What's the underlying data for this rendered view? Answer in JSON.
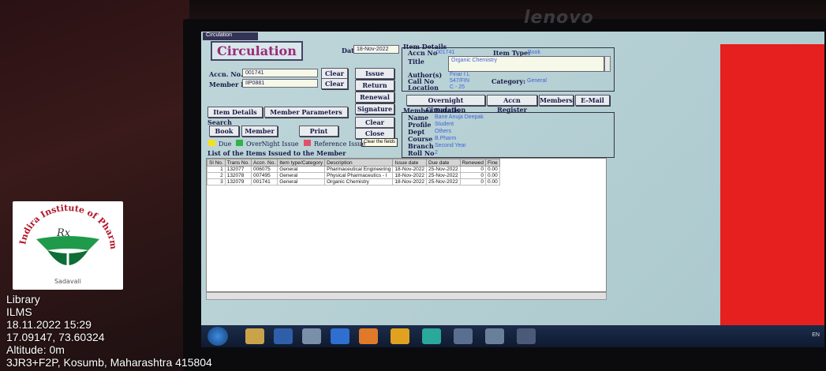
{
  "overlay": {
    "lines": [
      "Library",
      "ILMS",
      "18.11.2022 15:29",
      "17.09147, 73.60324",
      "Altitude: 0m",
      "3JR3+F2P, Kosumb, Maharashtra 415804"
    ]
  },
  "logo": {
    "arc_text": "Indira Institute of Pharmacy",
    "rx": "Rx",
    "caption": "Sadavali"
  },
  "monitor": {
    "brand": "lenovo"
  },
  "window": {
    "title": "Circulation",
    "form_title": "Circulation",
    "date_label": "Date",
    "date_value": "18-Nov-2022"
  },
  "accn": {
    "label": "Accn. No.",
    "value": "001741",
    "clear": "Clear"
  },
  "member": {
    "label": "Member ID",
    "value": "IIP0881",
    "clear": "Clear"
  },
  "actions": {
    "issue": "Issue",
    "return": "Return",
    "renewal": "Renewal",
    "signature": "Signature",
    "clear": "Clear",
    "close": "Close",
    "tooltip": "Clear the fields"
  },
  "tabs": {
    "item_details": "Item Details",
    "member_parameters": "Member Parameters"
  },
  "search": {
    "label": "Search",
    "book": "Book",
    "member": "Member",
    "print": "Print"
  },
  "legend": {
    "due": "Due",
    "overnight": "OverNight Issue",
    "reference": "Reference Issue",
    "colors": {
      "due": "#f2e21c",
      "overnight": "#2fb34a",
      "reference": "#e0526a"
    }
  },
  "list_title": "List of the Items Issued to the Member",
  "item_details": {
    "header": "Item Details",
    "accn_label": "Accn No",
    "accn_value": "001741",
    "type_label": "Item Type:",
    "type_value": "Book",
    "title_label": "Title",
    "title_value": "Organic Chemistry",
    "author_label": "Author(s)",
    "author_value": "Finar I L",
    "callno_label": "Call No",
    "callno_value": "547/FIN",
    "category_label": "Category:",
    "category_value": "General",
    "location_label": "Location",
    "location_value": "C - 25"
  },
  "nav": {
    "overnight": "Overnight Circulation",
    "accn_register": "Accn Register",
    "members": "Members",
    "email": "E-Mail"
  },
  "member_details": {
    "header": "Member Details",
    "name_label": "Name",
    "name_value": "Bane Anuja Deepak",
    "profile_label": "Profile",
    "profile_value": "Student",
    "dept_label": "Dept",
    "dept_value": "Others",
    "course_label": "Course",
    "course_value": "B.Pharm",
    "branch_label": "Branch",
    "branch_value": "Second Year",
    "roll_label": "Roll No",
    "roll_value": "2"
  },
  "table": {
    "columns": [
      "Sl No.",
      "Trans No.",
      "Accn. No.",
      "Item type/Category",
      "Description",
      "Issue date",
      "Due date",
      "Renewed",
      "Fine"
    ],
    "rows": [
      [
        "1",
        "132077",
        "006075",
        "General",
        "Pharmaceutical Engineering",
        "18-Nov-2022",
        "25-Nov-2022",
        "0",
        "0.00"
      ],
      [
        "2",
        "132078",
        "007495",
        "General",
        "Physical Pharmaceutics - I",
        "18-Nov-2022",
        "25-Nov-2022",
        "0",
        "0.00"
      ],
      [
        "3",
        "132079",
        "001741",
        "General",
        "Organic Chemistry",
        "18-Nov-2022",
        "25-Nov-2022",
        "0",
        "0.00"
      ]
    ]
  },
  "tray": {
    "lang": "EN"
  }
}
